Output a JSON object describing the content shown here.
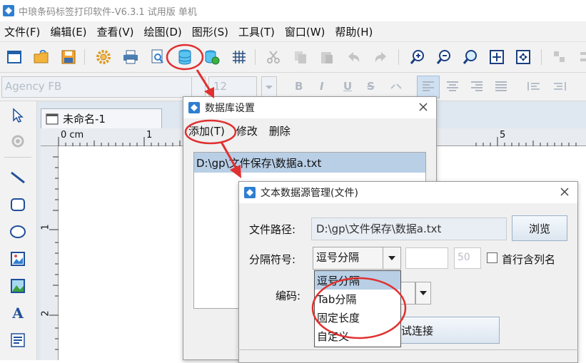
{
  "app": {
    "title": "中琅条码标签打印软件-V6.3.1 试用版 单机"
  },
  "menu": [
    "文件(F)",
    "编辑(E)",
    "查看(V)",
    "绘图(D)",
    "图形(S)",
    "工具(T)",
    "窗口(W)",
    "帮助(H)"
  ],
  "format_bar": {
    "font": "Agency FB",
    "size": "12",
    "bold": "B",
    "italic": "I",
    "underline": "U",
    "strike": "S"
  },
  "document": {
    "tab_title": "未命名-1"
  },
  "ruler": {
    "origin": "0 cm",
    "h_marks": [
      "1",
      "5"
    ],
    "v_marks": [
      "1",
      "2"
    ]
  },
  "db_dialog": {
    "title": "数据库设置",
    "menu": [
      "添加(T)",
      "修改",
      "删除"
    ],
    "items": [
      "D:\\gp\\文件保存\\数据a.txt"
    ]
  },
  "text_ds_dialog": {
    "title": "文本数据源管理(文件)",
    "path_label": "文件路径:",
    "path_value": "D:\\gp\\文件保存\\数据a.txt",
    "browse": "浏览",
    "separator_label": "分隔符号:",
    "separator_value": "逗号分隔",
    "separator_num": "50",
    "header_checkbox": "首行含列名",
    "encoding_label": "编码:",
    "test_button_partial": "测试连接",
    "separator_options": [
      "逗号分隔",
      "Tab分隔",
      "固定长度",
      "自定义"
    ]
  },
  "colors": {
    "highlight_red": "#e03030",
    "selection": "#b8cfe6",
    "accent_blue": "#2f7fd0"
  }
}
